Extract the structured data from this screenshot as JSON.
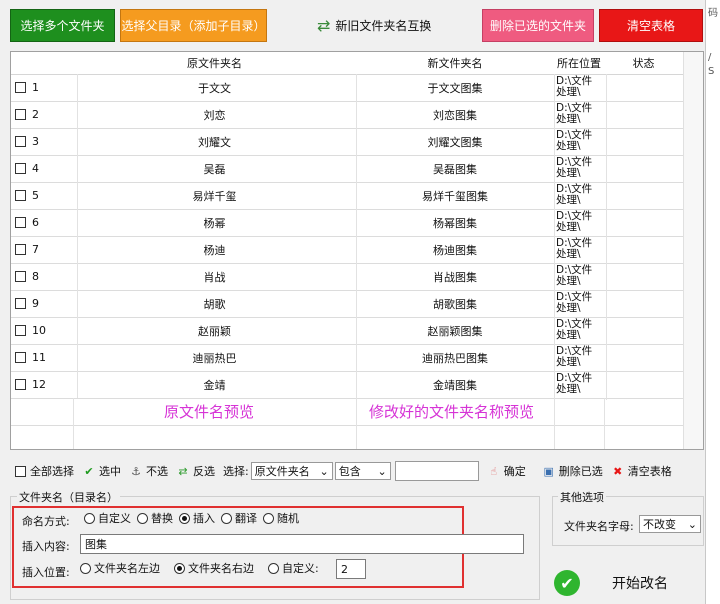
{
  "toolbar": {
    "select_multiple": "选择多个文件夹",
    "select_parent": "选择父目录（添加子目录）",
    "swap_names": "新旧文件夹名互换",
    "delete_selected": "删除已选的文件夹",
    "clear_table": "清空表格"
  },
  "right_strip": {
    "top": "码",
    "mid1": "/",
    "mid2": "S"
  },
  "table": {
    "headers": {
      "original": "原文件夹名",
      "new": "新文件夹名",
      "location": "所在位置",
      "status": "状态"
    },
    "location_line1": "D:\\文件",
    "location_line2": "处理\\",
    "rows": [
      {
        "num": "1",
        "original": "于文文",
        "new": "于文文图集"
      },
      {
        "num": "2",
        "original": "刘恋",
        "new": "刘恋图集"
      },
      {
        "num": "3",
        "original": "刘耀文",
        "new": "刘耀文图集"
      },
      {
        "num": "4",
        "original": "吴磊",
        "new": "吴磊图集"
      },
      {
        "num": "5",
        "original": "易烊千玺",
        "new": "易烊千玺图集"
      },
      {
        "num": "6",
        "original": "杨幂",
        "new": "杨幂图集"
      },
      {
        "num": "7",
        "original": "杨迪",
        "new": "杨迪图集"
      },
      {
        "num": "8",
        "original": "肖战",
        "new": "肖战图集"
      },
      {
        "num": "9",
        "original": "胡歌",
        "new": "胡歌图集"
      },
      {
        "num": "10",
        "original": "赵丽颖",
        "new": "赵丽颖图集"
      },
      {
        "num": "11",
        "original": "迪丽热巴",
        "new": "迪丽热巴图集"
      },
      {
        "num": "12",
        "original": "金靖",
        "new": "金靖图集"
      }
    ],
    "overlay_original": "原文件名预览",
    "overlay_new": "修改好的文件夹名称预览"
  },
  "selection_bar": {
    "select_all": "全部选择",
    "select": "选中",
    "deselect": "不选",
    "invert": "反选",
    "choose_label": "选择:",
    "field_value": "原文件夹名",
    "match_value": "包含",
    "search_value": "",
    "confirm": "确定",
    "delete_selected": "删除已选",
    "clear_table": "清空表格"
  },
  "naming_group": {
    "title": "文件夹名（目录名）",
    "mode_label": "命名方式:",
    "modes": [
      "自定义",
      "替换",
      "插入",
      "翻译",
      "随机"
    ],
    "selected_mode": "插入",
    "insert_content_label": "插入内容:",
    "insert_content_value": "图集",
    "insert_position_label": "插入位置:",
    "positions": [
      "文件夹名左边",
      "文件夹名右边",
      "自定义:"
    ],
    "selected_position": "文件夹名右边",
    "custom_position_value": "2"
  },
  "other_options": {
    "title": "其他选项",
    "letter_label": "文件夹名字母:",
    "letter_value": "不改变"
  },
  "start_button": {
    "label": "开始改名"
  },
  "colors": {
    "green": "#1e8f1e",
    "orange": "#f59b1f",
    "pink": "#ef5b80",
    "red": "#e81717",
    "overlay": "#d633d6",
    "highlight": "#e03030"
  }
}
